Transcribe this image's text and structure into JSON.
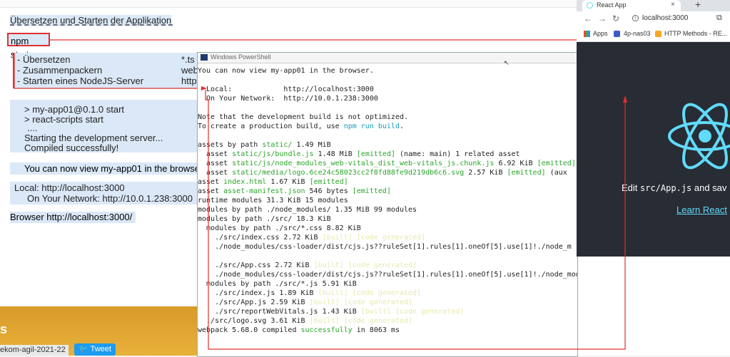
{
  "doc": {
    "title": "Übersetzen und Starten der Applikation",
    "npm_cmd": "npm start",
    "list": [
      {
        "text": "- Übersetzen",
        "ext": "*.ts"
      },
      {
        "text": "- Zusammenpackern",
        "ext": "web"
      },
      {
        "text": "- Starten eines NodeJS-Server",
        "ext": "http"
      }
    ],
    "output": [
      "> my-app01@0.1.0 start",
      "> react-scripts start",
      "....",
      "Starting the development server...",
      "Compiled successfully!"
    ],
    "view_line": "You can now view my-app01 in the browse",
    "local_line": "Local:            http://localhost:3000",
    "network_line": "On Your Network:  http://10.0.1.238:3000",
    "browser_line": "Browser http://localhost:3000/",
    "footer_tag": "ekom-agil-2021-22",
    "footer_s": "s",
    "tweet_label": "Tweet"
  },
  "powershell": {
    "title": "Windows PowerShell",
    "lines": [
      [
        {
          "t": "You can now view my-app01 in the browser."
        }
      ],
      [
        {
          "t": ""
        }
      ],
      [
        {
          "t": "  Local:            http://localhost:3000"
        }
      ],
      [
        {
          "t": "  On Your Network:  http://10.0.1.238:3000"
        }
      ],
      [
        {
          "t": ""
        }
      ],
      [
        {
          "t": "Note that the development build is not optimized."
        }
      ],
      [
        {
          "t": "To create a production build, use "
        },
        {
          "t": "npm run build",
          "c": "c"
        },
        {
          "t": "."
        }
      ],
      [
        {
          "t": ""
        }
      ],
      [
        {
          "t": "assets by path "
        },
        {
          "t": "static/",
          "c": "g"
        },
        {
          "t": " 1.49 MiB"
        }
      ],
      [
        {
          "t": "  asset "
        },
        {
          "t": "static/js/bundle.js",
          "c": "g"
        },
        {
          "t": " 1.48 MiB "
        },
        {
          "t": "[emitted]",
          "c": "g"
        },
        {
          "t": " (name: main) 1 related asset"
        }
      ],
      [
        {
          "t": "  asset "
        },
        {
          "t": "static/js/node_modules_web-vitals_dist_web-vitals_js.chunk.js",
          "c": "g"
        },
        {
          "t": " 6.92 KiB "
        },
        {
          "t": "[emitted]",
          "c": "g"
        }
      ],
      [
        {
          "t": "  asset "
        },
        {
          "t": "static/media/logo.6ce24c58023cc2f8fd88fe9d219db6c6.svg",
          "c": "g"
        },
        {
          "t": " 2.57 KiB "
        },
        {
          "t": "[emitted]",
          "c": "g"
        },
        {
          "t": " (aux"
        }
      ],
      [
        {
          "t": "asset "
        },
        {
          "t": "index.html",
          "c": "g"
        },
        {
          "t": " 1.67 KiB "
        },
        {
          "t": "[emitted]",
          "c": "g"
        }
      ],
      [
        {
          "t": "asset "
        },
        {
          "t": "asset-manifest.json",
          "c": "g"
        },
        {
          "t": " 546 bytes "
        },
        {
          "t": "[emitted]",
          "c": "g"
        }
      ],
      [
        {
          "t": "runtime modules 31.3 KiB 15 modules"
        }
      ],
      [
        {
          "t": "modules by path ./node_modules/ 1.35 MiB 99 modules"
        }
      ],
      [
        {
          "t": "modules by path ./src/ 18.3 KiB"
        }
      ],
      [
        {
          "t": "  modules by path ./src/*.css 8.82 KiB"
        }
      ],
      [
        {
          "t": "    ./src/index.css 2.72 KiB "
        },
        {
          "t": "[built] [code generated]",
          "c": "y"
        }
      ],
      [
        {
          "t": "    ./node_modules/css-loader/dist/cjs.js??ruleSet[1].rules[1].oneOf[5].use[1]!./node_m"
        }
      ],
      [
        {
          "t": ""
        }
      ],
      [
        {
          "t": "    ./src/App.css 2.72 KiB "
        },
        {
          "t": "[built] [code generated]",
          "c": "y"
        }
      ],
      [
        {
          "t": "    ./node_modules/css-loader/dist/cjs.js??ruleSet[1].rules[1].oneOf[5].use[1]!./node_modules/postcss-loader/dist/cjs.js?"
        }
      ],
      [
        {
          "t": "  modules by path ./src/*.js 5.91 KiB"
        }
      ],
      [
        {
          "t": "    ./src/index.js 1.89 KiB "
        },
        {
          "t": "[built] [code generated]",
          "c": "y"
        }
      ],
      [
        {
          "t": "    ./src/App.js 2.59 KiB "
        },
        {
          "t": "[built] [code generated]",
          "c": "y"
        }
      ],
      [
        {
          "t": "    ./src/reportWebVitals.js 1.43 KiB "
        },
        {
          "t": "[built] [code generated]",
          "c": "y"
        }
      ],
      [
        {
          "t": "  ./src/logo.svg 3.61 KiB "
        },
        {
          "t": "[built] [code generated]",
          "c": "y"
        }
      ],
      [
        {
          "t": "webpack 5.68.0 compiled "
        },
        {
          "t": "successfully",
          "c": "g"
        },
        {
          "t": " in 8063 ms"
        }
      ]
    ]
  },
  "browser": {
    "tab_title": "React App",
    "tab_close": "×",
    "new_tab": "+",
    "url": "localhost:3000",
    "bookmarks": [
      "Apps",
      "4p-nas03",
      "HTTP Methods - RE..."
    ],
    "edit_prefix": "Edit ",
    "edit_code": "src/App.js",
    "edit_suffix": " and sav",
    "learn_link": "Learn React"
  },
  "colors": {
    "accent_red": "#e03030",
    "react_blue": "#61dafb",
    "react_bg": "#282c34",
    "highlight": "#dbe8f7"
  }
}
